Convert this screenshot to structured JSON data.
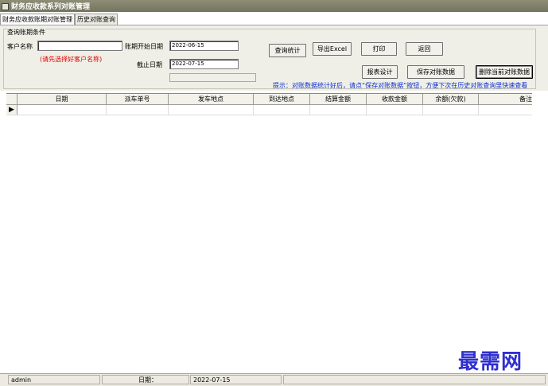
{
  "window": {
    "title": "财务应收款系列对账管理"
  },
  "tabs": [
    {
      "label": "财务应收款账期对账管理",
      "active": true
    },
    {
      "label": "历史对账查询",
      "active": false
    }
  ],
  "query": {
    "group_title": "查询账期条件",
    "customer_label": "客户名称",
    "customer_value": "",
    "customer_hint": "(请先选择好客户名称)",
    "start_label": "账期开始日期",
    "start_value": "2022-06-15",
    "end_label": "截止日期",
    "end_value": "2022-07-15",
    "extra_value": ""
  },
  "buttons": {
    "query_stats": "查询统计",
    "export_excel": "导出Excel",
    "print": "打印",
    "back": "返回",
    "report_design": "报表设计",
    "save_data": "保存对账数据",
    "delete_current": "删除当前对账数据"
  },
  "tip": "提示：对账数据统计好后，请点“保存对账数据”按钮，方便下次在历史对账查询里快速查看",
  "grid": {
    "columns": [
      "日期",
      "派车单号",
      "发车地点",
      "到达地点",
      "结算金额",
      "收款金额",
      "余额(欠款)",
      "备注"
    ]
  },
  "status": {
    "user": "admin",
    "date_label": "日期：",
    "date_value": "2022-07-15"
  },
  "watermark": "最需网",
  "colors": {
    "tip": "#0a2fd6",
    "hint": "#e00000",
    "watermark": "#2f2fcf"
  }
}
